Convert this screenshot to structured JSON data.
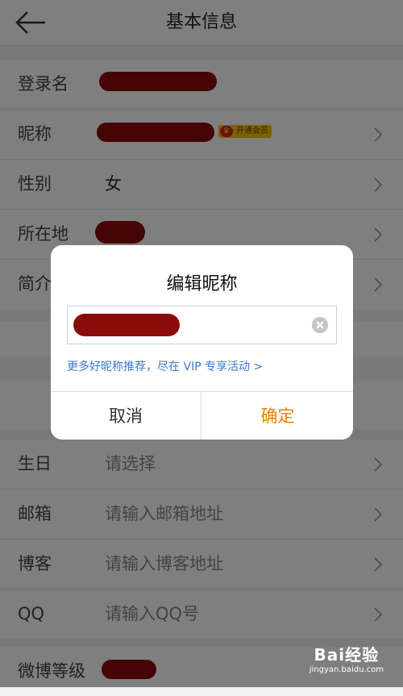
{
  "header": {
    "title": "基本信息",
    "back_icon": "arrow-left-icon"
  },
  "rows_group1": [
    {
      "label": "登录名",
      "value": ""
    },
    {
      "label": "昵称",
      "value": "",
      "badge": "开通会员"
    },
    {
      "label": "性别",
      "value": "女"
    },
    {
      "label": "所在地",
      "value": ""
    },
    {
      "label": "简介",
      "value": ""
    }
  ],
  "rows_group3": [
    {
      "label": "生日",
      "placeholder": "请选择"
    },
    {
      "label": "邮箱",
      "placeholder": "请输入邮箱地址"
    },
    {
      "label": "博客",
      "placeholder": "请输入博客地址"
    },
    {
      "label": "QQ",
      "placeholder": "请输入QQ号"
    }
  ],
  "rows_group4": [
    {
      "label": "微博等级",
      "value": ""
    }
  ],
  "dialog": {
    "title": "编辑昵称",
    "input_value": "",
    "promo": "更多好昵称推荐，尽在 VIP 专享活动 >",
    "cancel": "取消",
    "confirm": "确定"
  },
  "colors": {
    "confirm": "#f08000",
    "link": "#3a7ac8",
    "redaction": "#8b0a0a",
    "vip": "#f6c700"
  },
  "watermark": {
    "brand": "Bai经验",
    "url": "jingyan.baidu.com"
  }
}
